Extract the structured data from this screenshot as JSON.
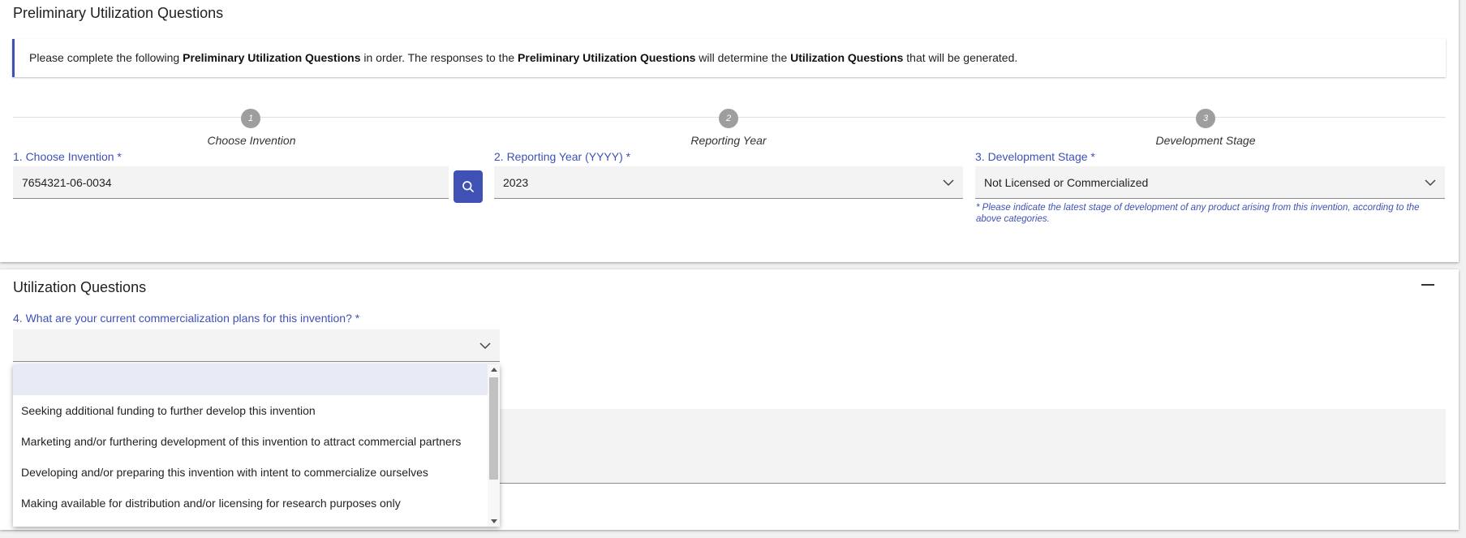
{
  "prelim": {
    "title": "Preliminary Utilization Questions",
    "info": {
      "t1": "Please complete the following ",
      "b1": "Preliminary Utilization Questions",
      "t2": " in order. The responses to the ",
      "b2": "Preliminary Utilization Questions",
      "t3": " will determine the ",
      "b3": "Utilization Questions",
      "t4": " that will be generated."
    },
    "steps": [
      {
        "num": "1",
        "label": "Choose Invention"
      },
      {
        "num": "2",
        "label": "Reporting Year"
      },
      {
        "num": "3",
        "label": "Development Stage"
      }
    ],
    "fields": {
      "invention": {
        "label": "1. Choose Invention *",
        "value": "7654321-06-0034"
      },
      "year": {
        "label": "2. Reporting Year (YYYY) *",
        "value": "2023"
      },
      "stage": {
        "label": "3. Development Stage *",
        "value": "Not Licensed or Commercialized",
        "helper": "* Please indicate the latest stage of development of any product arising from this invention, according to the above categories."
      }
    }
  },
  "util": {
    "title": "Utilization Questions",
    "q4": {
      "label": "4. What are your current commercialization plans for this invention? *",
      "value": ""
    },
    "dropdown_options": [
      "",
      "Seeking additional funding to further develop this invention",
      "Marketing and/or furthering development of this invention to attract commercial partners",
      "Developing and/or preparing this invention with intent to commercialize ourselves",
      "Making available for distribution and/or licensing for research purposes only"
    ]
  },
  "colors": {
    "accent": "#3f51b5",
    "step_circle": "#9e9e9e",
    "field_bg": "#f3f3f3",
    "selected_option": "#e8eaf6"
  },
  "icons": [
    "search-icon",
    "chevron-down-icon",
    "collapse-icon"
  ]
}
